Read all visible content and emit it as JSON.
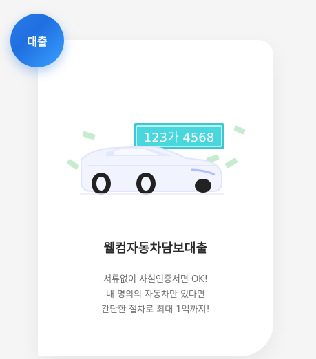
{
  "badge": {
    "label": "대출"
  },
  "product": {
    "plate_number": "123가 4568",
    "title": "웰컴자동차담보대출",
    "description_lines": [
      "서류없이 사설인증서면 OK!",
      "내 명의의 자동차만 있다면",
      "간단한 절차로 최대 1억까지!"
    ]
  },
  "colors": {
    "badge_blue": "#2b7de9",
    "plate_cyan": "#4fd1d6",
    "money_green": "#bfe6c5"
  },
  "icons": {
    "car": "car-illustration",
    "money": "money-bill-icon"
  }
}
